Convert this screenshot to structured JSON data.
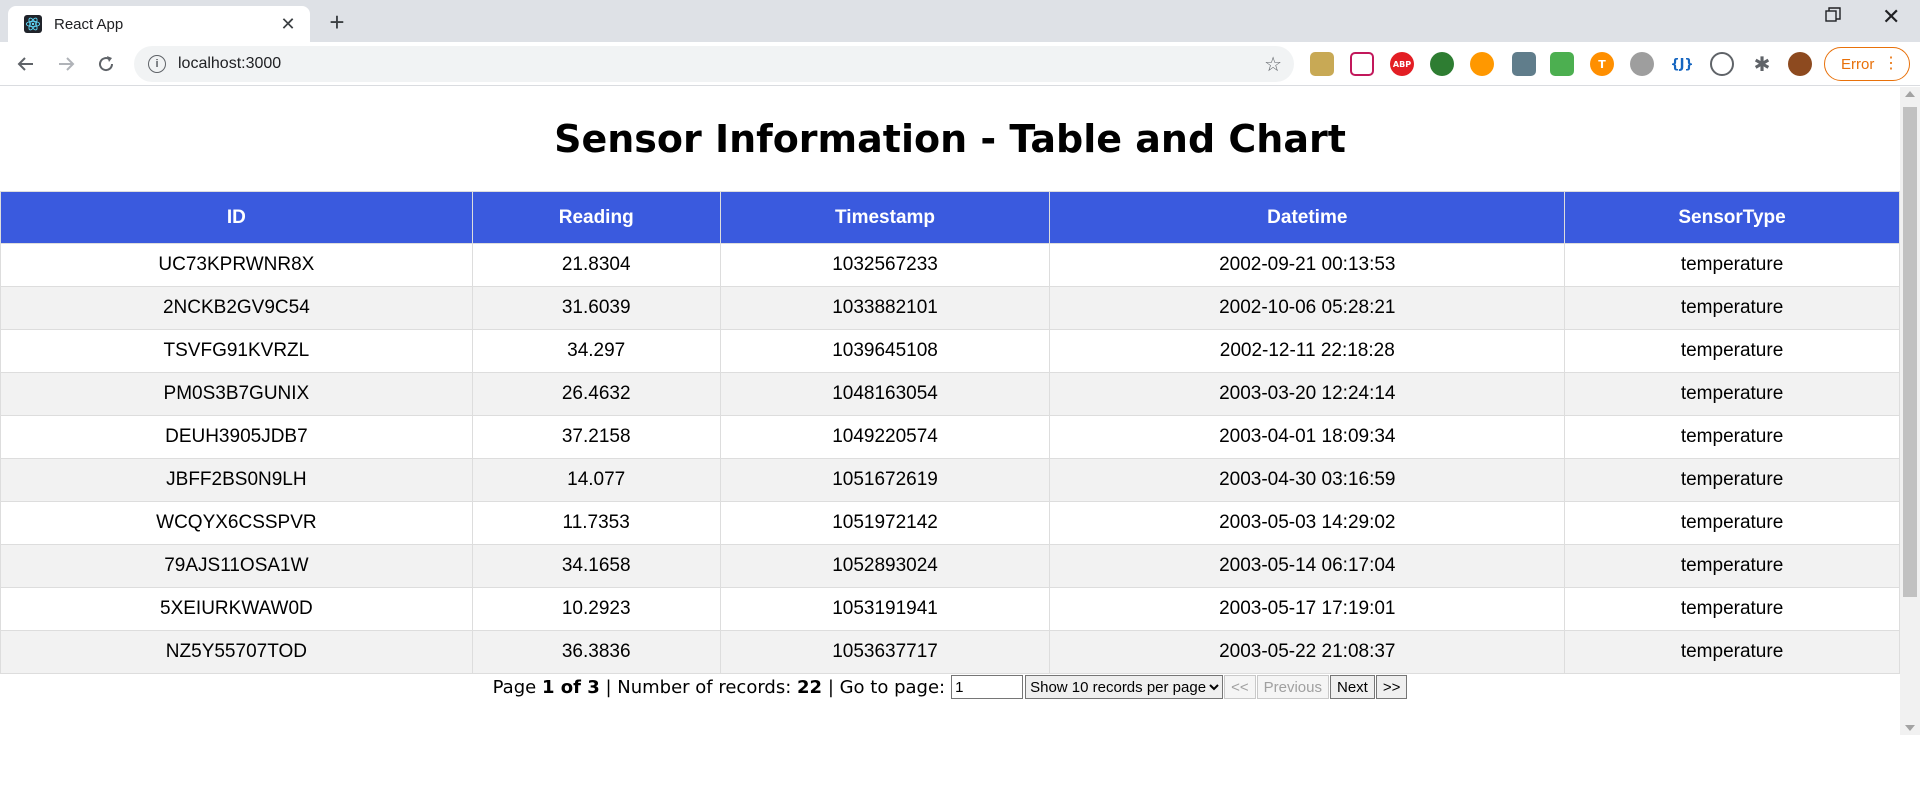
{
  "browser": {
    "tab_title": "React App",
    "url": "localhost:3000",
    "error_label": "Error",
    "extension_abp_label": "ABP",
    "extension_json_label": "{J}"
  },
  "page": {
    "title": "Sensor Information - Table and Chart"
  },
  "table": {
    "headers": [
      "ID",
      "Reading",
      "Timestamp",
      "Datetime",
      "SensorType"
    ],
    "rows": [
      [
        "UC73KPRWNR8X",
        "21.8304",
        "1032567233",
        "2002-09-21 00:13:53",
        "temperature"
      ],
      [
        "2NCKB2GV9C54",
        "31.6039",
        "1033882101",
        "2002-10-06 05:28:21",
        "temperature"
      ],
      [
        "TSVFG91KVRZL",
        "34.297",
        "1039645108",
        "2002-12-11 22:18:28",
        "temperature"
      ],
      [
        "PM0S3B7GUNIX",
        "26.4632",
        "1048163054",
        "2003-03-20 12:24:14",
        "temperature"
      ],
      [
        "DEUH3905JDB7",
        "37.2158",
        "1049220574",
        "2003-04-01 18:09:34",
        "temperature"
      ],
      [
        "JBFF2BS0N9LH",
        "14.077",
        "1051672619",
        "2003-04-30 03:16:59",
        "temperature"
      ],
      [
        "WCQYX6CSSPVR",
        "11.7353",
        "1051972142",
        "2003-05-03 14:29:02",
        "temperature"
      ],
      [
        "79AJS11OSA1W",
        "34.1658",
        "1052893024",
        "2003-05-14 06:17:04",
        "temperature"
      ],
      [
        "5XEIURKWAW0D",
        "10.2923",
        "1053191941",
        "2003-05-17 17:19:01",
        "temperature"
      ],
      [
        "NZ5Y55707TOD",
        "36.3836",
        "1053637717",
        "2003-05-22 21:08:37",
        "temperature"
      ]
    ]
  },
  "pagination": {
    "page_prefix": "Page",
    "page_of": "1 of 3",
    "records_prefix": "| Number of records:",
    "records_count": "22",
    "goto_prefix": "| Go to page:",
    "goto_value": "1",
    "page_size_selected": "Show 10 records per page",
    "first_label": "<<",
    "previous_label": "Previous",
    "next_label": "Next",
    "last_label": ">>"
  },
  "colors": {
    "header_bg": "#3a5ade",
    "stripe_bg": "#f2f2f2"
  }
}
